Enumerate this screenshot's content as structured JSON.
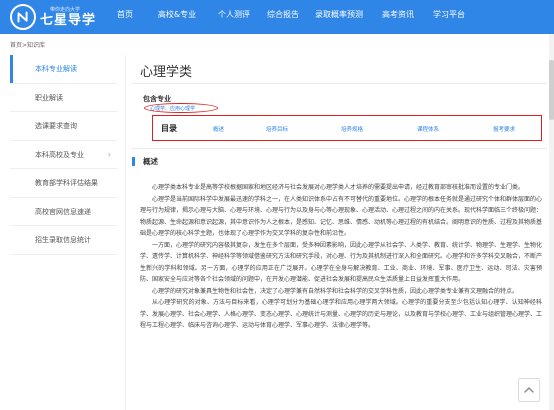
{
  "brand": {
    "slogan": "带你走向大学",
    "name": "七星导学"
  },
  "nav": [
    {
      "label": "首页"
    },
    {
      "label": "高校&专业"
    },
    {
      "label": "个人测评"
    },
    {
      "label": "综合报告"
    },
    {
      "label": "录取概率预测"
    },
    {
      "label": "高考资讯"
    },
    {
      "label": "学习平台"
    }
  ],
  "breadcrumb": {
    "home": "首页",
    "sep": ">",
    "current": "知识库"
  },
  "sidebar": {
    "items": [
      {
        "label": "本科专业解读",
        "active": true
      },
      {
        "label": "职业解读"
      },
      {
        "label": "选课要求查询"
      },
      {
        "label": "本科高校及专业",
        "chevron": "›"
      },
      {
        "label": "教育部学科评估结果"
      },
      {
        "label": "高校官网信息速递"
      },
      {
        "label": "招生录取信息统计"
      }
    ]
  },
  "main": {
    "title": "心理学类",
    "contains_label": "包含专业",
    "tags": "心理学、应用心理学",
    "toc": {
      "title": "目录",
      "items": [
        "概述",
        "培养目标",
        "培养规格",
        "课程体系",
        "报考要求"
      ]
    },
    "section_title": "概述",
    "paragraphs": [
      "心理学类本科专业是高等学校根据国家和地区经济与社会发展对心理学类人才培养的需要提出申请，经过教育部审核批准而设置的专业门类。",
      "心理学是当前国际科学中发展最迅速的学科之一，在人类知识体系中占有不可替代的重要地位。心理学的根本任务就是通过研究个体和群体层面的心理与行为规律，揭示心理与大脑、心理与环境、心理与行为以及身与心等心理现象、心理活动、心理过程之间的内在关系。现代科学面临三个终极问题：物质起源、生命起源和意识起源，其中意识作为人之根本，是感知、记忆、思维、情感、动机等心理过程的有机结合。阐明意识的性质、过程及其物质基础是心理学的核心科学主题，也体现了心理学作为交叉学科的复杂性和前沿性。",
      "一方面，心理学的研究内容极其复杂，发生在多个层面，受多种因素影响，因此心理学从社会学、人类学、教育、统计学、物理学、生理学、生物化学、遗传学、计算机科学、神经科学等领域借鉴研究方法和研究手段，对心理、行为及其机制进行深入和全面研究。心理学和许多学科交叉融合，不断产生新兴的学科和领域。另一方面，心理学的应用正在广泛展开。心理学在全身与解决教育、工业、商业、环境、军事、医疗卫生、运动、司法、灾害预防、国家安全与应对等各个社会领域的问题中，在开发心理潜能、促进社会发展和提高民众生活质量上日益发挥重大作用。",
      "心理学的研究对象兼具生物性和社会性，决定了心理学兼有自然科学和社会科学的交叉学科性质，因此心理学类专业兼有文理融合的特点。",
      "从心理学研究的对象、方法与目标来看，心理学可划分为基础心理学和应用心理学两大领域。心理学的重要分支至少包括认知心理学、认知神经科学、发展心理学、社会心理学、人格心理学、变态心理学、心理统计与测量、心理学的历史与理论，以及教育与学校心理学、工业与组织管理心理学、工程与工程心理学、临床与咨询心理学、运动与体育心理学、军事心理学、法律心理学等。"
    ]
  },
  "colors": {
    "accent": "#2f86e6",
    "highlight_red": "#e02020"
  },
  "icons": {
    "logo": "stylized-n-logo-icon",
    "back_to_top": "up-arrow-icon",
    "bullet": "blue-bar-icon"
  }
}
